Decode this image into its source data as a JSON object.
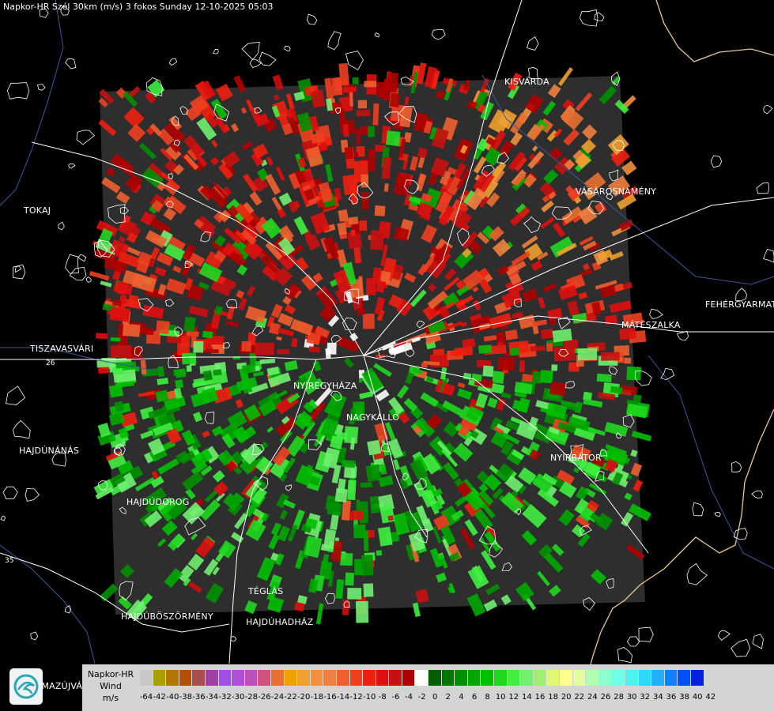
{
  "title": "Napkor-HR Szél 30km (m/s) 3 fokos Sunday 12-10-2025 05:03",
  "cities": [
    "KISVÁRDA",
    "VÁSÁROSNAMÉNY",
    "TOKAJ",
    "FEHÉRGYARMAT",
    "MÁTÉSZALKA",
    "TISZAVASVÁRI",
    "NYÍREGYHÁZA",
    "NAGYKÁLLÓ",
    "HAJDÚNÁNÁS",
    "NYÍRBÁTOR",
    "HAJDÚDOROG",
    "TÉGLÁS",
    "HAJDÚBÖSZÖRMÉNY",
    "HAJDÚHADHÁZ",
    "HMAZÚJVÁROS"
  ],
  "road_numbers": [
    "26",
    "35"
  ],
  "legend": {
    "title_lines": [
      "Napkor-HR",
      "Wind",
      "m/s"
    ],
    "ticks": [
      "-64",
      "-42",
      "-40",
      "-38",
      "-36",
      "-34",
      "-32",
      "-30",
      "-28",
      "-26",
      "-24",
      "-22",
      "-20",
      "-18",
      "-16",
      "-14",
      "-12",
      "-10",
      "-8",
      "-6",
      "-4",
      "-2",
      "0",
      "2",
      "4",
      "6",
      "8",
      "10",
      "12",
      "14",
      "16",
      "18",
      "20",
      "22",
      "24",
      "26",
      "28",
      "30",
      "32",
      "34",
      "36",
      "38",
      "40",
      "42"
    ],
    "colors": [
      "#c8c8c8",
      "#a8a000",
      "#b07800",
      "#b05000",
      "#a85050",
      "#a040a0",
      "#a050e8",
      "#b050d8",
      "#c050b8",
      "#d05080",
      "#e87030",
      "#f0a000",
      "#f0a030",
      "#f09040",
      "#f08040",
      "#f06030",
      "#f04020",
      "#f02010",
      "#e01010",
      "#c81010",
      "#b00000",
      "#ffffff",
      "#006000",
      "#007800",
      "#009000",
      "#00a800",
      "#00c000",
      "#20d820",
      "#40f040",
      "#70f070",
      "#a0f070",
      "#e0f870",
      "#ffff90",
      "#e0ffa0",
      "#b0ffb0",
      "#90ffd0",
      "#70ffe8",
      "#50f0f0",
      "#30d8ff",
      "#20b0ff",
      "#1080ff",
      "#0050ff",
      "#0020e0"
    ]
  },
  "colors": {
    "radar_bg": "#2e2e2e",
    "road": "#ffffff",
    "river": "#3a5a9a",
    "border": "#e6c890",
    "boundary": "#ffffff"
  },
  "icons": [
    "napkor-logo-icon"
  ]
}
